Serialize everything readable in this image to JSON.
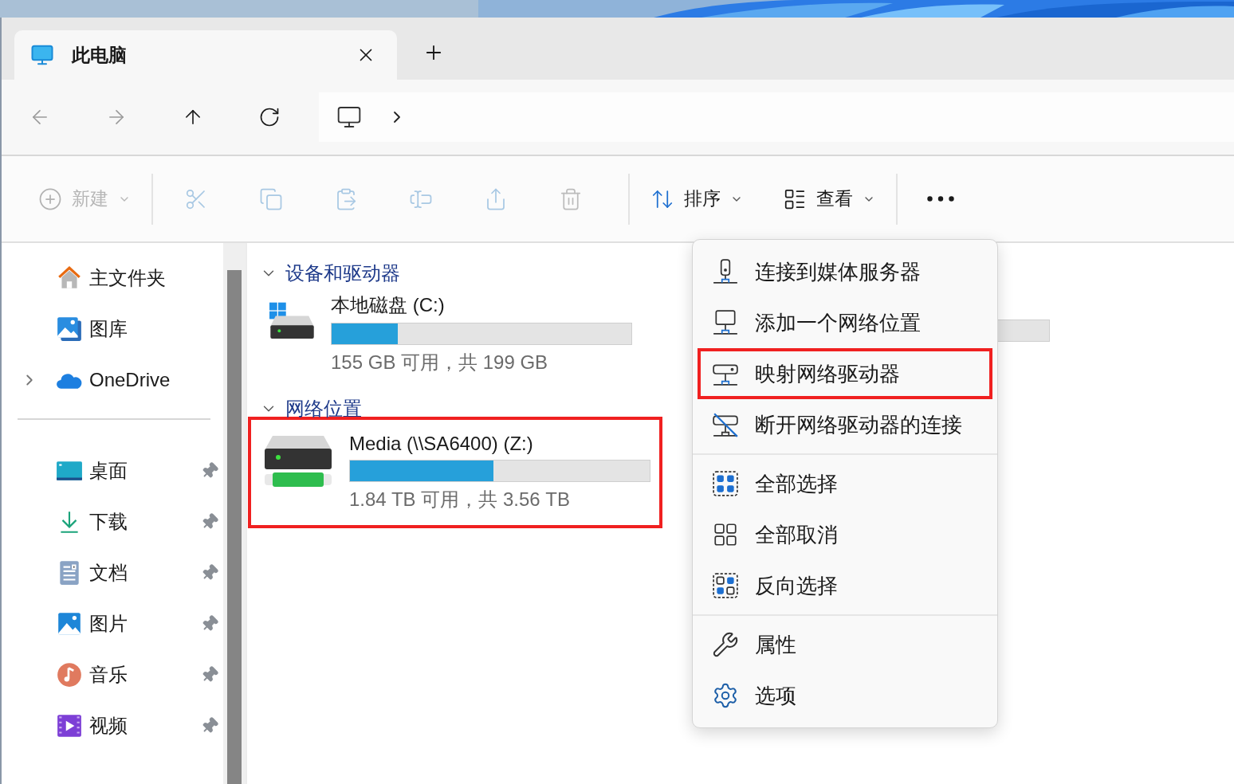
{
  "tab": {
    "title": "此电脑",
    "selected": true
  },
  "toolbar": [
    {
      "kind": "new",
      "label": "新建",
      "disabled": true
    },
    {
      "kind": "cut",
      "disabled": true
    },
    {
      "kind": "copy",
      "disabled": true
    },
    {
      "kind": "paste",
      "disabled": true
    },
    {
      "kind": "rename",
      "disabled": true
    },
    {
      "kind": "share",
      "disabled": true
    },
    {
      "kind": "delete",
      "disabled": true
    },
    {
      "kind": "sort",
      "label": "排序",
      "disabled": false
    },
    {
      "kind": "view",
      "label": "查看",
      "disabled": false
    },
    {
      "kind": "more",
      "disabled": false
    }
  ],
  "sidebar": {
    "top": [
      {
        "kind": "home",
        "label": "主文件夹",
        "expandable": false,
        "pinned": false
      },
      {
        "kind": "gallery",
        "label": "图库",
        "expandable": false,
        "pinned": false
      },
      {
        "kind": "cloud",
        "label": "OneDrive",
        "expandable": true,
        "pinned": false
      }
    ],
    "quick": [
      {
        "kind": "desktop",
        "label": "桌面",
        "expandable": false,
        "pinned": true
      },
      {
        "kind": "download",
        "label": "下载",
        "expandable": false,
        "pinned": true
      },
      {
        "kind": "document",
        "label": "文档",
        "expandable": false,
        "pinned": true
      },
      {
        "kind": "picture",
        "label": "图片",
        "expandable": false,
        "pinned": true
      },
      {
        "kind": "music",
        "label": "音乐",
        "expandable": false,
        "pinned": true
      },
      {
        "kind": "video",
        "label": "视频",
        "expandable": false,
        "pinned": true
      }
    ]
  },
  "sections": [
    {
      "title": "设备和驱动器",
      "expanded": true,
      "drives": [
        {
          "kind": "system",
          "name": "本地磁盘 (C:)",
          "level": 0.22,
          "reading": "155 GB 可用，共 199 GB",
          "highlighted": false
        },
        {
          "kind": "covered",
          "highlighted": false
        }
      ]
    },
    {
      "title": "网络位置",
      "expanded": true,
      "drives": [
        {
          "kind": "network",
          "name": "Media (\\\\SA6400) (Z:)",
          "level": 0.48,
          "reading": "1.84 TB 可用，共 3.56 TB",
          "highlighted": true
        }
      ]
    }
  ],
  "menu": {
    "groups": [
      [
        {
          "kind": "media-server",
          "label": "连接到媒体服务器",
          "highlighted": false
        },
        {
          "kind": "network-location",
          "label": "添加一个网络位置",
          "highlighted": false
        },
        {
          "kind": "map-drive",
          "label": "映射网络驱动器",
          "highlighted": true
        },
        {
          "kind": "disconnect",
          "label": "断开网络驱动器的连接",
          "highlighted": false
        }
      ],
      [
        {
          "kind": "select-all",
          "label": "全部选择",
          "highlighted": false
        },
        {
          "kind": "select-none",
          "label": "全部取消",
          "highlighted": false
        },
        {
          "kind": "invert",
          "label": "反向选择",
          "highlighted": false
        }
      ],
      [
        {
          "kind": "properties",
          "label": "属性",
          "highlighted": false
        },
        {
          "kind": "options",
          "label": "选项",
          "highlighted": false
        }
      ]
    ]
  }
}
